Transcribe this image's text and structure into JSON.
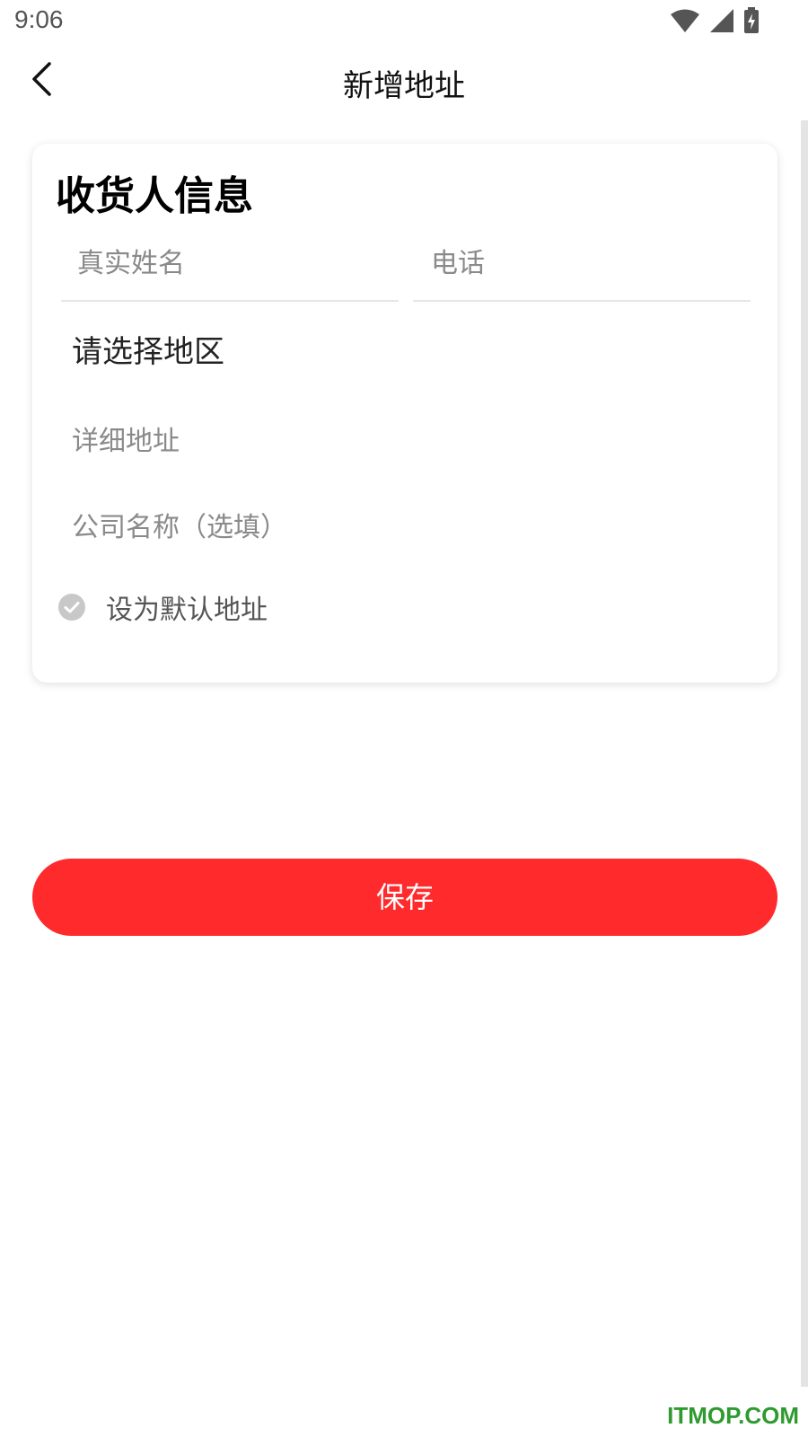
{
  "status_bar": {
    "time": "9:06",
    "icons": [
      "wifi-icon",
      "signal-icon",
      "battery-charging-icon"
    ]
  },
  "header": {
    "title": "新增地址",
    "back_icon": "chevron-left-icon"
  },
  "form": {
    "section_title": "收货人信息",
    "name_placeholder": "真实姓名",
    "phone_placeholder": "电话",
    "region_value": "请选择地区",
    "detail_placeholder": "详细地址",
    "company_placeholder": "公司名称（选填）",
    "default_label": "设为默认地址",
    "default_checked": false
  },
  "actions": {
    "save_label": "保存"
  },
  "watermark": "ITMOP.COM",
  "colors": {
    "accent": "#ff2a2c",
    "placeholder": "#8a8a8a",
    "divider": "#e6e6e6",
    "check_inactive": "#c8c8c8",
    "watermark": "#2f9a2f"
  }
}
